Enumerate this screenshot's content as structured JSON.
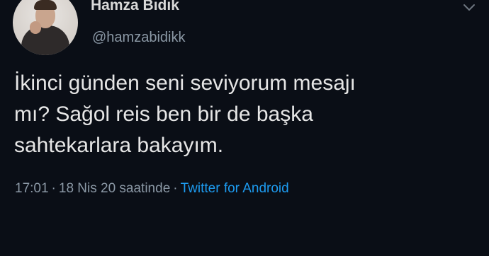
{
  "author": {
    "display_name": "Hamza Bıdık",
    "handle": "@hamzabidikk"
  },
  "tweet": {
    "lines": [
      "İkinci günden seni seviyorum mesajı",
      "mı? Sağol reis ben bir de başka",
      "sahtekarlara bakayım."
    ]
  },
  "meta": {
    "time": "17:01",
    "separator": "·",
    "date": "18 Nis 20 saatinde",
    "source": "Twitter for Android"
  },
  "icons": {
    "menu": "chevron-down-icon",
    "avatar": "avatar"
  },
  "colors": {
    "background": "#0a0e16",
    "text": "#e6e6e6",
    "muted": "#8b98a5",
    "link": "#1d9bf0"
  }
}
